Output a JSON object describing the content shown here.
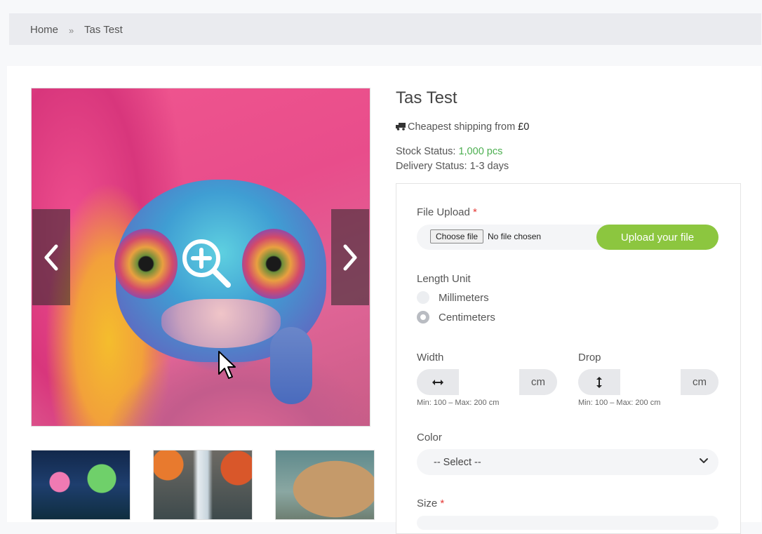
{
  "breadcrumb": {
    "home": "Home",
    "separator": "»",
    "current": "Tas Test"
  },
  "product": {
    "title": "Tas Test",
    "shipping_text": "Cheapest shipping from ",
    "shipping_price": "£0",
    "stock_label": "Stock Status: ",
    "stock_value": "1,000 pcs",
    "delivery_text": "Delivery Status: 1-3 days"
  },
  "form": {
    "file_upload_label": "File Upload",
    "required_mark": "*",
    "choose_file": "Choose file",
    "no_file": "No file chosen",
    "upload_button": "Upload your file",
    "length_unit_label": "Length Unit",
    "units": [
      "Millimeters",
      "Centimeters"
    ],
    "selected_unit": "Centimeters",
    "width_label": "Width",
    "drop_label": "Drop",
    "unit_suffix": "cm",
    "width_hint": "Min: 100 – Max: 200 cm",
    "drop_hint": "Min: 100 – Max: 200 cm",
    "color_label": "Color",
    "color_value": "-- Select --",
    "size_label": "Size"
  },
  "gallery": {
    "main_image": "chameleon",
    "thumbnails": [
      "fantasy-forest",
      "waterfall",
      "brain"
    ]
  },
  "colors": {
    "accent_green": "#8cc63f",
    "stock_green": "#4caf50",
    "required_red": "#e53935"
  }
}
